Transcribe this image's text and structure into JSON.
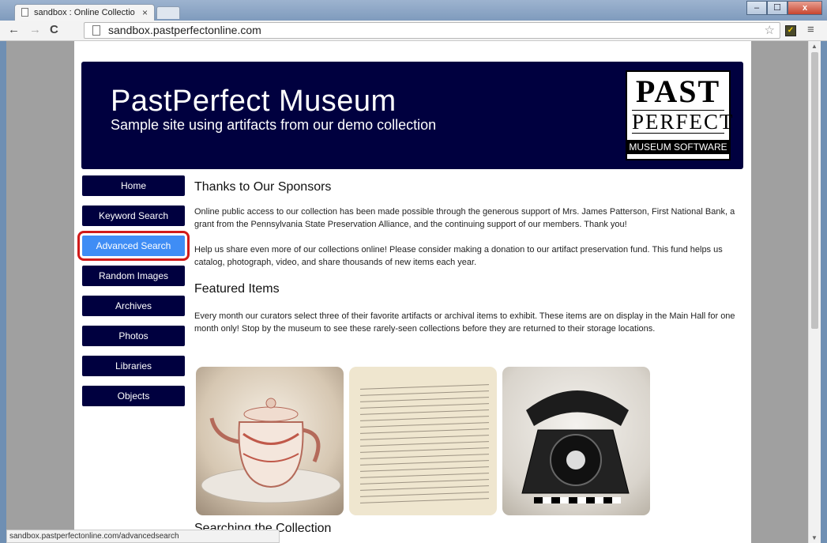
{
  "browser": {
    "tab_title": "sandbox : Online Collectio",
    "tab_close": "×",
    "url": "sandbox.pastperfectonline.com",
    "status_url": "sandbox.pastperfectonline.com/advancedsearch",
    "nav": {
      "back": "←",
      "forward": "→",
      "reload": "C"
    },
    "window_controls": {
      "minimize": "‒",
      "maximize": "☐",
      "close": "x"
    },
    "star": "☆",
    "menu": "≡",
    "extension": "✓"
  },
  "banner": {
    "title": "PastPerfect Museum",
    "subtitle": "Sample site using artifacts from our demo collection",
    "logo_past": "PAST",
    "logo_perfect": "PERFECT",
    "logo_sub": "MUSEUM SOFTWARE"
  },
  "nav_items": [
    {
      "label": "Home"
    },
    {
      "label": "Keyword Search"
    },
    {
      "label": "Advanced Search",
      "active": true
    },
    {
      "label": "Random Images"
    },
    {
      "label": "Archives"
    },
    {
      "label": "Photos"
    },
    {
      "label": "Libraries"
    },
    {
      "label": "Objects"
    }
  ],
  "content": {
    "sponsors_heading": "Thanks to Our Sponsors",
    "sponsors_text": "Online public access to our collection has been made possible through the generous support of Mrs. James Patterson, First National Bank, a grant from the Pennsylvania State Preservation Alliance, and the continuing support of our members. Thank you!",
    "donate_text": "Help us share even more of our collections online! Please consider making a donation to our artifact preservation fund. This fund helps us catalog, photograph, video, and share thousands of new items each year.",
    "featured_heading": "Featured Items",
    "featured_text": "Every month our curators select three of their favorite artifacts or archival items to exhibit. These items are on display in the Main Hall for one month only! Stop by the museum to see these rarely-seen collections before they are returned to their storage locations.",
    "searching_heading": "Searching the Collection"
  },
  "colors": {
    "banner": "#00003f",
    "nav_button": "#00003f",
    "active_button": "#3f8df5",
    "highlight": "#d11a1a"
  }
}
